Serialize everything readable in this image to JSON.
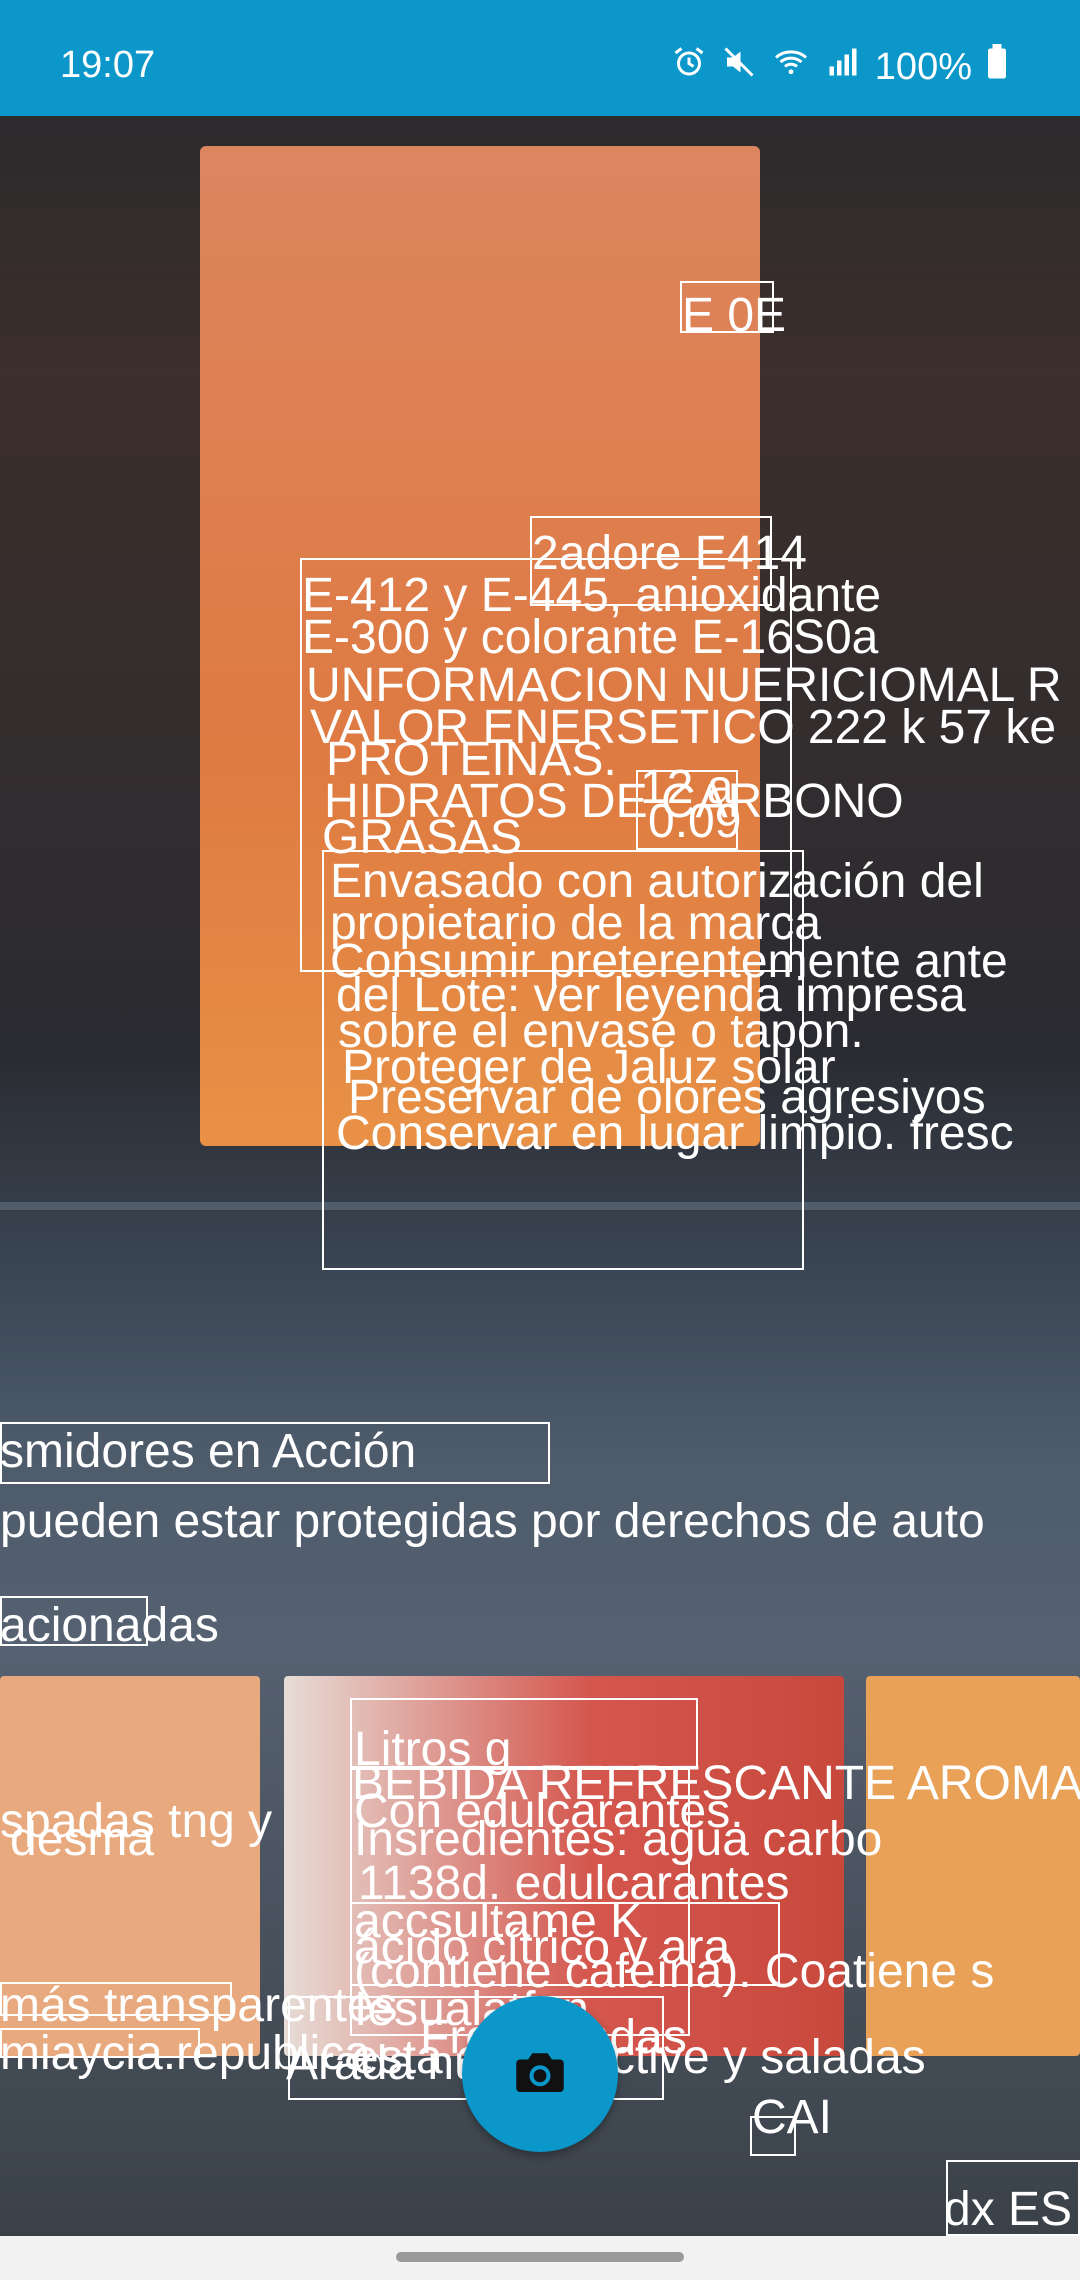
{
  "status_bar": {
    "time": "19:07",
    "battery_percent": "100%",
    "icons": [
      "alarm-icon",
      "mute-icon",
      "wifi-icon",
      "signal-icon",
      "battery-icon"
    ]
  },
  "ocr_lines": [
    "E 0E",
    "2adore E414",
    "E-412 y E-445, anioxidante",
    "E-300 y colorante E-16S0a",
    "UNFORMACION NUERICIOMAL R",
    "VALOR ENERSETICO 222 k 57 ke",
    "PROTEINAS.",
    "12 a",
    "HIDRATOS DE CARBONO",
    "0.09",
    "GRASAS",
    "Envasado con autorización del",
    "propietario de la marca",
    "Consumir preterentemente ante",
    "del Lote: ver leyenda impresa",
    "sobre el envase o tapon.",
    "Proteger de Jaluz solar",
    "Preservar de olores agresiyos",
    "Conservar en lugar limpio. fresc",
    "smidores en Acción",
    "pueden estar protegidas por derechos de auto",
    "acionadas",
    "Litros g",
    "BEBIDA REFRESCANTE AROMA",
    "Con edulcarantes.",
    "spadas tng y",
    "desma",
    "Insredientes: agua carbo",
    "1138d. edulcarantes",
    "accsultame K",
    "ácido cítrico y ara",
    "(contiene cafeína). Coatiene s",
    "más transparentes",
    "Iesualatfan",
    "Frec bandas",
    "Arada nuevas",
    "miaycia.republica",
    "esta ancia active y saladas",
    "CAI",
    "dx ES"
  ]
}
